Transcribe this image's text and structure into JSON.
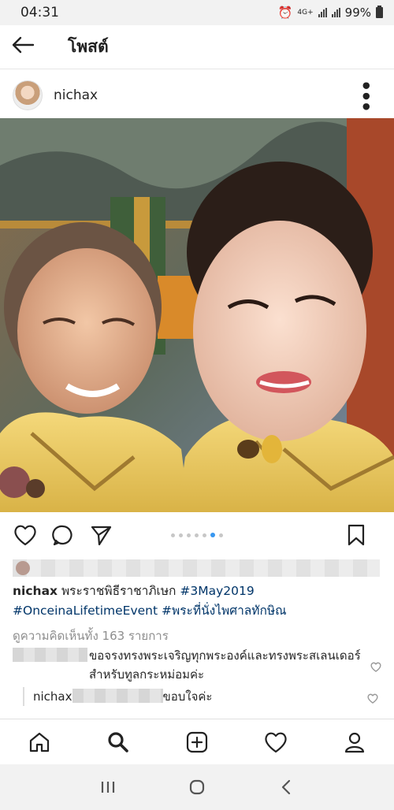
{
  "status_bar": {
    "time": "04:31",
    "network": "4G+",
    "battery": "99%"
  },
  "header": {
    "back_icon": "arrow-left-icon",
    "title": "โพสต์"
  },
  "post": {
    "username": "nichax",
    "carousel": {
      "count": 7,
      "active_index": 5
    },
    "caption": {
      "username": "nichax",
      "text": "พระราชพิธีราชาภิเษก",
      "hashtag1": "#3May2019",
      "hashtag2": "#OnceinaLifetimeEvent",
      "hashtag3": "#พระที่นั่งไพศาลทักษิณ"
    },
    "view_comments": "ดูความคิดเห็นทั้ง 163 รายการ",
    "comments": [
      {
        "text": "ขอจรงทรงพระเจริญทุกพระองค์และทรงพระสเลนเดอร์สำหรับทูลกระหม่อมค่ะ"
      },
      {
        "username": "nichax",
        "text": "ขอบใจค่ะ"
      }
    ]
  },
  "tabs": [
    {
      "icon": "home-icon"
    },
    {
      "icon": "search-icon"
    },
    {
      "icon": "add-post-icon"
    },
    {
      "icon": "heart-icon"
    },
    {
      "icon": "profile-icon"
    }
  ],
  "colors": {
    "hashtag": "#003569",
    "carousel_active": "#3897f0",
    "muted": "#8e8e8e"
  }
}
